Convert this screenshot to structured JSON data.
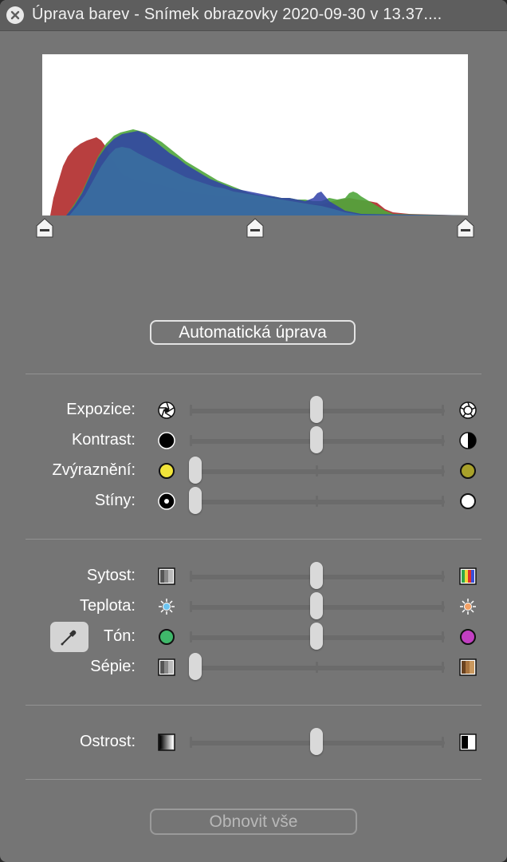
{
  "window": {
    "title": "Úprava barev - Snímek obrazovky 2020-09-30 v 13.37...."
  },
  "histogram": {
    "colors": {
      "red": "#b02a2a",
      "green": "#4fa63b",
      "blue": "#2f3fa8",
      "mix": "#3a6ea0"
    },
    "levels": {
      "black_point": 0,
      "midpoint": 0.5,
      "white_point": 1
    }
  },
  "auto_button": {
    "label": "Automatická úprava"
  },
  "sections": {
    "light": [
      {
        "key": "exposure",
        "label": "Expozice:",
        "icon_left": "aperture-closed-icon",
        "icon_right": "aperture-open-icon",
        "value": 0.5
      },
      {
        "key": "contrast",
        "label": "Kontrast:",
        "icon_left": "black-circle-icon",
        "icon_right": "half-circle-icon",
        "value": 0.5
      },
      {
        "key": "highlights",
        "label": "Zvýraznění:",
        "icon_left": "yellow-circle-icon",
        "icon_right": "olive-circle-icon",
        "value": 0.0
      },
      {
        "key": "shadows",
        "label": "Stíny:",
        "icon_left": "black-dot-circle-icon",
        "icon_right": "white-circle-icon",
        "value": 0.0
      }
    ],
    "color": [
      {
        "key": "saturation",
        "label": "Sytost:",
        "icon_left": "gray-bars-icon",
        "icon_right": "color-bars-icon",
        "value": 0.5
      },
      {
        "key": "temperature",
        "label": "Teplota:",
        "icon_left": "cool-sun-icon",
        "icon_right": "warm-sun-icon",
        "value": 0.5
      },
      {
        "key": "tint",
        "label": "Tón:",
        "icon_left": "green-circle-icon",
        "icon_right": "magenta-circle-icon",
        "value": 0.5
      },
      {
        "key": "sepia",
        "label": "Sépie:",
        "icon_left": "gray-bars-icon",
        "icon_right": "sepia-bars-icon",
        "value": 0.0
      }
    ],
    "detail": [
      {
        "key": "sharpness",
        "label": "Ostrost:",
        "icon_left": "soft-gradient-icon",
        "icon_right": "sharp-edge-icon",
        "value": 0.5
      }
    ]
  },
  "reset_button": {
    "label": "Obnovit vše"
  }
}
